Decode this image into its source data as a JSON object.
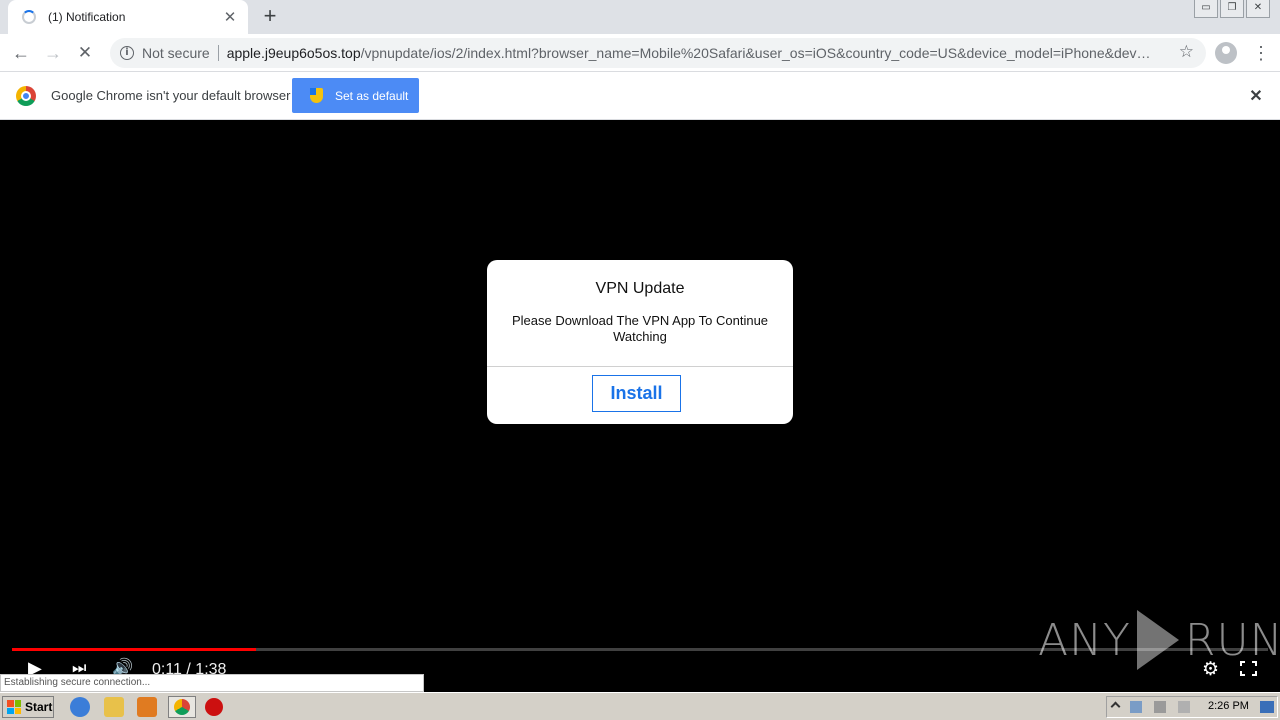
{
  "tab": {
    "title": "(1) Notification",
    "close": "✕",
    "new_tab": "+"
  },
  "window_controls": {
    "minimize": "▭",
    "restore": "❐",
    "close": "✕"
  },
  "toolbar": {
    "back": "←",
    "forward": "→",
    "stop": "✕",
    "security_label": "Not secure",
    "url_host": "apple.j9eup6o5os.top",
    "url_path": "/vpnupdate/ios/2/index.html?browser_name=Mobile%20Safari&user_os=iOS&country_code=US&device_model=iPhone&device_...",
    "star": "☆",
    "menu": "⋮"
  },
  "infobar": {
    "message": "Google Chrome isn't your default browser",
    "button_label": "Set as default",
    "close": "✕"
  },
  "dialog": {
    "title": "VPN Update",
    "body": "Please Download The VPN App To Continue Watching",
    "button_label": "Install"
  },
  "player": {
    "play": "▶",
    "next": "⏭",
    "volume": "🔊",
    "time": "0:11 / 1:38",
    "settings": "⚙",
    "progress_fraction": 0.194
  },
  "watermark": {
    "left": "ANY",
    "right": "RUN"
  },
  "status_text": "Establishing secure connection...",
  "taskbar": {
    "start_label": "Start",
    "clock": "2:26 PM"
  },
  "colors": {
    "progress": "#ff0000",
    "install_accent": "#1a73e8",
    "set_default_button": "#4c8bf5"
  }
}
